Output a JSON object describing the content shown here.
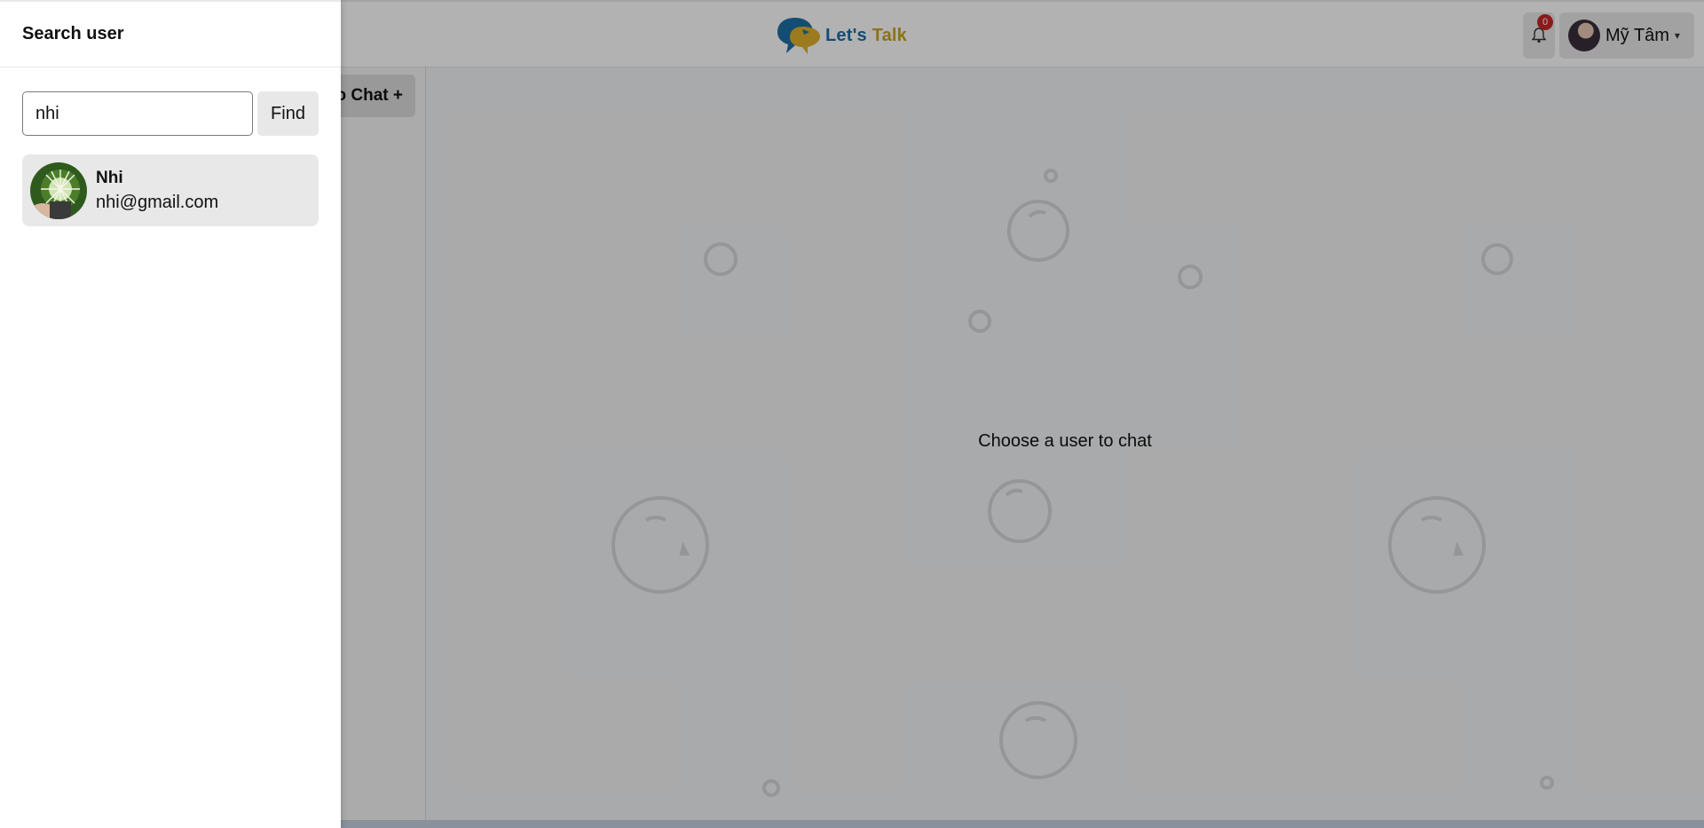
{
  "header": {
    "logo_text_part1": "Let's",
    "logo_text_part2": "Talk",
    "notification_count": "0",
    "user_name": "Mỹ Tâm"
  },
  "left_panel": {
    "group_chat_label": "o Chat +"
  },
  "chat_area": {
    "placeholder": "Choose a user to chat"
  },
  "drawer": {
    "title": "Search user",
    "search_value": "nhi",
    "find_label": "Find",
    "results": [
      {
        "name": "Nhi",
        "email": "nhi@gmail.com"
      }
    ]
  },
  "icons": {
    "bell": "bell-icon",
    "caret": "chevron-down-icon"
  },
  "colors": {
    "logo_blue": "#1d6fa5",
    "logo_gold": "#c9a227",
    "badge": "#c62828"
  }
}
